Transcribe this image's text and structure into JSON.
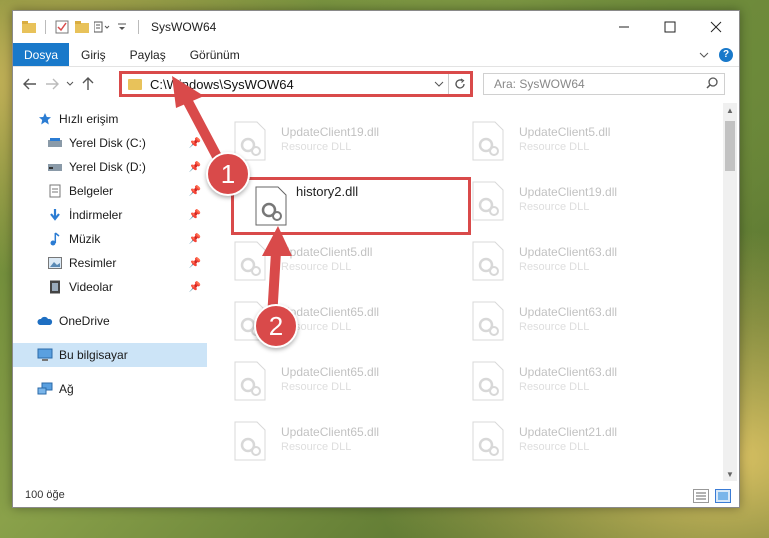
{
  "window": {
    "title": "SysWOW64"
  },
  "ribbon": {
    "file_tab": "Dosya",
    "tabs": [
      "Giriş",
      "Paylaş",
      "Görünüm"
    ]
  },
  "address": {
    "path": "C:\\Windows\\SysWOW64",
    "search_placeholder": "Ara: SysWOW64"
  },
  "sidebar": {
    "items": [
      {
        "label": "Hızlı erişim",
        "icon": "star-icon"
      },
      {
        "label": "Yerel Disk (C:)",
        "icon": "drive-icon"
      },
      {
        "label": "Yerel Disk (D:)",
        "icon": "drive-icon"
      },
      {
        "label": "Belgeler",
        "icon": "documents-icon"
      },
      {
        "label": "İndirmeler",
        "icon": "download-icon"
      },
      {
        "label": "Müzik",
        "icon": "music-icon"
      },
      {
        "label": "Resimler",
        "icon": "pictures-icon"
      },
      {
        "label": "Videolar",
        "icon": "videos-icon"
      },
      {
        "label": "OneDrive",
        "icon": "cloud-icon"
      },
      {
        "label": "Bu bilgisayar",
        "icon": "computer-icon"
      },
      {
        "label": "Ağ",
        "icon": "network-icon"
      }
    ]
  },
  "files": {
    "col1": [
      {
        "name": "UpdateClient19.dll",
        "desc": "Resource DLL"
      },
      {
        "name": "history2.dll",
        "desc": ""
      },
      {
        "name": "UpdateClient5.dll",
        "desc": "Resource DLL"
      },
      {
        "name": "UpdateClient65.dll",
        "desc": "Resource DLL"
      },
      {
        "name": "UpdateClient65.dll",
        "desc": "Resource DLL"
      },
      {
        "name": "UpdateClient65.dll",
        "desc": "Resource DLL"
      }
    ],
    "col2": [
      {
        "name": "UpdateClient5.dll",
        "desc": "Resource DLL"
      },
      {
        "name": "UpdateClient19.dll",
        "desc": "Resource DLL"
      },
      {
        "name": "UpdateClient63.dll",
        "desc": "Resource DLL"
      },
      {
        "name": "UpdateClient63.dll",
        "desc": "Resource DLL"
      },
      {
        "name": "UpdateClient63.dll",
        "desc": "Resource DLL"
      },
      {
        "name": "UpdateClient21.dll",
        "desc": "Resource DLL"
      }
    ]
  },
  "status": {
    "count": "100 öğe"
  },
  "annotations": {
    "step1": "1",
    "step2": "2",
    "color": "#d94a4a"
  }
}
